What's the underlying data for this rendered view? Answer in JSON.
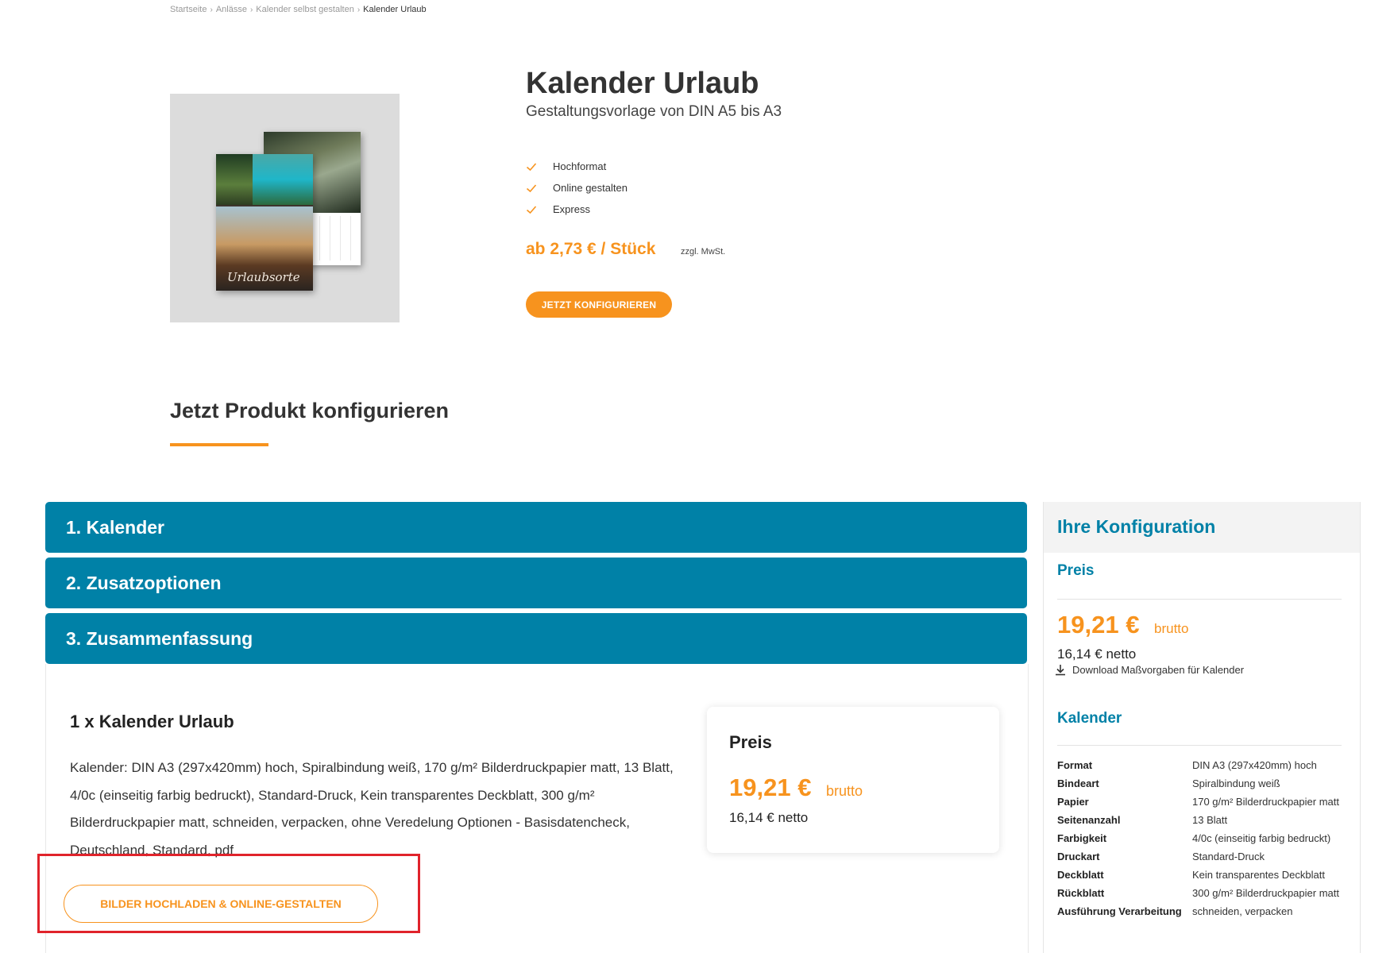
{
  "breadcrumb": {
    "items": [
      "Startseite",
      "Anlässe",
      "Kalender selbst gestalten",
      "Kalender Urlaub"
    ],
    "separator": "›"
  },
  "product": {
    "title": "Kalender Urlaub",
    "subtitle": "Gestaltungsvorlage von DIN A5 bis A3",
    "features": [
      "Hochformat",
      "Online gestalten",
      "Express"
    ],
    "price_from": "ab 2,73 € / Stück",
    "price_note": "zzgl. MwSt.",
    "cta_label": "JETZT KONFIGURIEREN",
    "image_script_title": "Urlaubsorte"
  },
  "configure": {
    "heading": "Jetzt Produkt konfigurieren",
    "steps": [
      "1. Kalender",
      "2. Zusatzoptionen",
      "3. Zusammenfassung"
    ]
  },
  "summary": {
    "item_title": "1 x Kalender Urlaub",
    "description": "Kalender: DIN A3 (297x420mm) hoch, Spiralbindung weiß, 170 g/m² Bilderdruckpapier matt, 13 Blatt, 4/0c (einseitig farbig bedruckt), Standard-Druck, Kein transparentes Deckblatt, 300 g/m² Bilderdruckpapier matt, schneiden, verpacken, ohne Veredelung Optionen - Basisdatencheck, Deutschland, Standard, pdf",
    "price_card": {
      "title": "Preis",
      "brutto_value": "19,21 €",
      "brutto_label": "brutto",
      "netto": "16,14 € netto"
    },
    "upload_label": "BILDER HOCHLADEN & ONLINE-GESTALTEN"
  },
  "sidebar": {
    "title": "Ihre Konfiguration",
    "preis_heading": "Preis",
    "price": "19,21 €",
    "brutto_label": "brutto",
    "netto": "16,14 € netto",
    "download_label": "Download Maßvorgaben für Kalender",
    "kalender_heading": "Kalender",
    "specs": [
      {
        "key": "Format",
        "value": "DIN A3 (297x420mm) hoch"
      },
      {
        "key": "Bindeart",
        "value": "Spiralbindung weiß"
      },
      {
        "key": "Papier",
        "value": "170 g/m² Bilderdruckpapier matt"
      },
      {
        "key": "Seitenanzahl",
        "value": "13 Blatt"
      },
      {
        "key": "Farbigkeit",
        "value": "4/0c (einseitig farbig bedruckt)"
      },
      {
        "key": "Druckart",
        "value": "Standard-Druck"
      },
      {
        "key": "Deckblatt",
        "value": "Kein transparentes Deckblatt"
      },
      {
        "key": "Rückblatt",
        "value": "300 g/m² Bilderdruckpapier matt"
      },
      {
        "key": "Ausführung Verarbeitung",
        "value": "schneiden, verpacken"
      }
    ]
  },
  "colors": {
    "accent": "#f7931e",
    "primary": "#0081a7",
    "highlight": "#e0232b"
  },
  "icons": {
    "check": "check-icon",
    "download": "download-icon"
  }
}
